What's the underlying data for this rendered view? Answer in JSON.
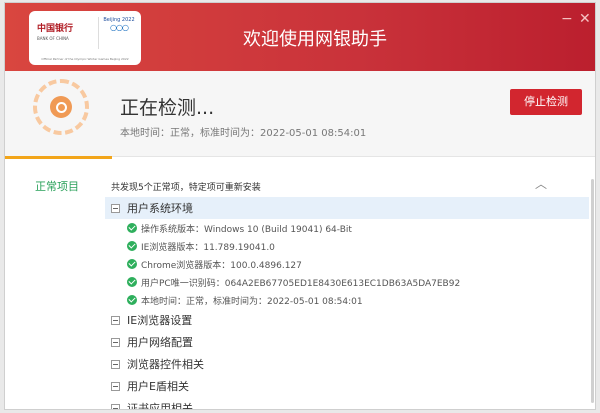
{
  "header": {
    "title": "欢迎使用网银助手",
    "logo": {
      "bank": "中国银行",
      "bank_en": "BANK OF CHINA",
      "games": "Beijing 2022",
      "partner": "Official Partner of the Olympic Winter Games Beijing 2022"
    },
    "minimize": "−",
    "close": "✕"
  },
  "status": {
    "title": "正在检测...",
    "local_time": "本地时间：正常，标准时间为：2022-05-01 08:54:01",
    "stop_button": "停止检测"
  },
  "content": {
    "category": "正常项目",
    "summary": "共发现5个正常项，特定项可重新安装",
    "collapse_icon": "︿",
    "groups": [
      {
        "label": "用户系统环境",
        "items": [
          "操作系统版本：Windows 10  (Build 19041) 64-Bit",
          "IE浏览器版本：11.789.19041.0",
          "Chrome浏览器版本：100.0.4896.127",
          "用户PC唯一识别码：064A2EB67705ED1E8430E613EC1DB63A5DA7EB92",
          "本地时间：正常，标准时间为：2022-05-01 08:54:01"
        ]
      },
      {
        "label": "IE浏览器设置"
      },
      {
        "label": "用户网络配置"
      },
      {
        "label": "浏览器控件相关"
      },
      {
        "label": "用户E盾相关"
      },
      {
        "label": "证书应用相关"
      }
    ]
  }
}
